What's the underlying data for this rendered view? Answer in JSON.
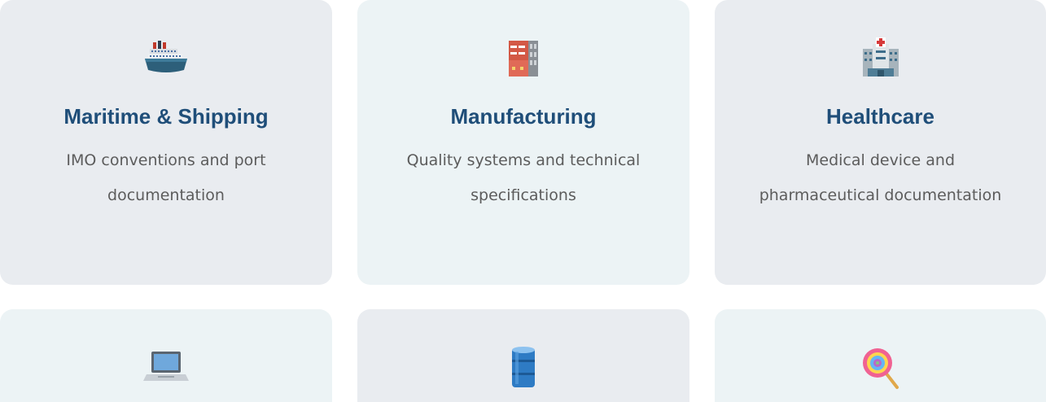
{
  "cards": [
    {
      "title": "Maritime & Shipping",
      "description": "IMO conventions and port documentation",
      "icon": "ship-icon"
    },
    {
      "title": "Manufacturing",
      "description": "Quality systems and technical specifications",
      "icon": "factory-icon"
    },
    {
      "title": "Healthcare",
      "description": "Medical device and pharmaceutical documentation",
      "icon": "hospital-icon"
    },
    {
      "title": "",
      "description": "",
      "icon": "laptop-icon"
    },
    {
      "title": "",
      "description": "",
      "icon": "oil-drum-icon"
    },
    {
      "title": "",
      "description": "",
      "icon": "lollipop-icon"
    }
  ]
}
